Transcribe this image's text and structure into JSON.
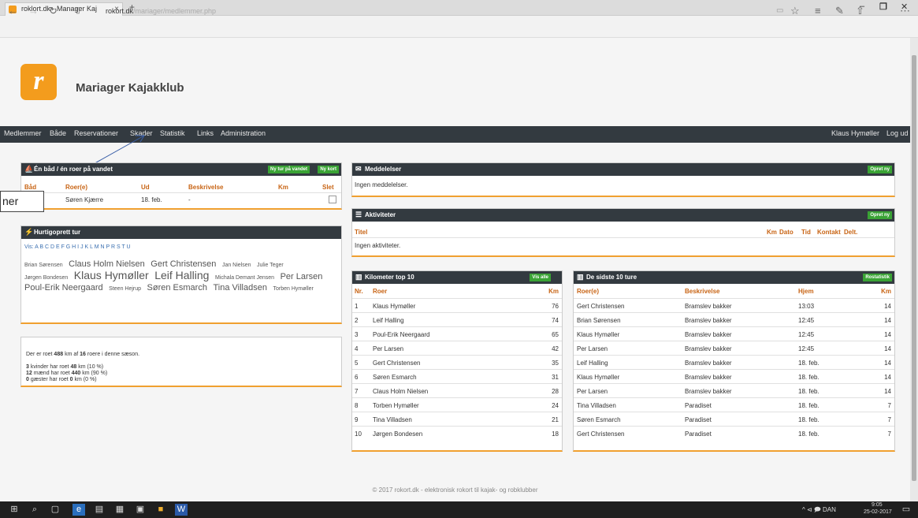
{
  "browser": {
    "tab_title": "roklort.dk - Manager Kaj",
    "tab_close": "×",
    "new_tab": "+",
    "address_host": "rokort.dk",
    "address_path": "/mariager/medlemmer.php",
    "win_min": "–",
    "win_max": "❐",
    "win_close": "✕",
    "icons": {
      "back": "arrow-left-icon",
      "forward": "arrow-right-icon",
      "refresh": "refresh-icon",
      "lock": "page-icon",
      "reading": "reading-view-icon",
      "favorite": "star-icon",
      "hub": "hub-icon",
      "notes": "pen-icon",
      "share": "share-icon",
      "more": "more-icon"
    }
  },
  "site": {
    "title": "Mariager Kajakklub",
    "logo_glyph": "r"
  },
  "menu": {
    "items": [
      "Medlemmer",
      "Både",
      "Reservationer",
      "Skader",
      "Statistik",
      "Links",
      "Administration"
    ],
    "user": "Klaus Hymøller",
    "logout": "Log ud"
  },
  "callout": {
    "text": "ner"
  },
  "panel_boats": {
    "title": "Én båd / én roer på vandet",
    "btn1": "Ny tur på vandet",
    "btn2": "Ny kort",
    "headers": [
      "Båd",
      "Roer(e)",
      "Ud",
      "Beskrivelse",
      "Km",
      "Slet"
    ],
    "row": {
      "boat": "",
      "rower": "Søren Kjærre",
      "out": "18. feb.",
      "desc": "-",
      "km": ""
    }
  },
  "panel_quick": {
    "title": "Hurtigoprett tur",
    "vis_label": "Vis:",
    "letters": "A B C D E F G H I J K L M N P R S T U",
    "names": [
      {
        "t": "Brian Sørensen",
        "s": 7
      },
      {
        "t": "Claus Holm Nielsen",
        "s": 11
      },
      {
        "t": "Gert Christensen",
        "s": 11
      },
      {
        "t": "Jan Nielsen",
        "s": 7
      },
      {
        "t": "Julie Teger",
        "s": 7
      },
      {
        "t": "Jørgen Bondesen",
        "s": 7
      },
      {
        "t": "Klaus Hymøller",
        "s": 14
      },
      {
        "t": "Leif Halling",
        "s": 14
      },
      {
        "t": "Michala Demant Jensen",
        "s": 7
      },
      {
        "t": "Per Larsen",
        "s": 11
      },
      {
        "t": "Poul-Erik Neergaard",
        "s": 11
      },
      {
        "t": "Steen Hejrup",
        "s": 7
      },
      {
        "t": "Søren Esmarch",
        "s": 11
      },
      {
        "t": "Tina Villadsen",
        "s": 11
      },
      {
        "t": "Torben Hymøller",
        "s": 7
      }
    ]
  },
  "panel_stats": {
    "line1_a": "Der er roet",
    "line1_km": "488",
    "line1_b": "km af",
    "line1_n": "16",
    "line1_c": "roere i denne sæson.",
    "line2_a": "3",
    "line2_b": "kvinder har roet",
    "line2_km": "48",
    "line2_c": "km (10 %)",
    "line3_a": "12",
    "line3_b": "mænd har roet",
    "line3_km": "440",
    "line3_c": "km (90 %)",
    "line4_a": "0",
    "line4_b": "gæster har roet",
    "line4_km": "0",
    "line4_c": "km (0 %)"
  },
  "panel_msg": {
    "title": "Meddelelser",
    "btn": "Opret ny",
    "text": "Ingen meddelelser."
  },
  "panel_act": {
    "title": "Aktiviteter",
    "btn": "Opret ny",
    "headers": [
      "Titel",
      "Km",
      "Dato",
      "Tid",
      "Kontakt",
      "Delt."
    ],
    "text": "Ingen aktiviteter."
  },
  "panel_top": {
    "title": "Kilometer top 10",
    "btn": "Vis alle",
    "headers": [
      "Nr.",
      "Roer",
      "Km"
    ],
    "rows": [
      [
        "1",
        "Klaus Hymøller",
        "76"
      ],
      [
        "2",
        "Leif Halling",
        "74"
      ],
      [
        "3",
        "Poul-Erik Neergaard",
        "65"
      ],
      [
        "4",
        "Per Larsen",
        "42"
      ],
      [
        "5",
        "Gert Christensen",
        "35"
      ],
      [
        "6",
        "Søren Esmarch",
        "31"
      ],
      [
        "7",
        "Claus Holm Nielsen",
        "28"
      ],
      [
        "8",
        "Torben Hymøller",
        "24"
      ],
      [
        "9",
        "Tina Villadsen",
        "21"
      ],
      [
        "10",
        "Jørgen Bondesen",
        "18"
      ]
    ]
  },
  "panel_last": {
    "title": "De sidste 10 ture",
    "btn": "Rostatistik",
    "headers": [
      "Roer(e)",
      "Beskrivelse",
      "Hjem",
      "Km"
    ],
    "rows": [
      [
        "Gert Christensen",
        "Bramslev bakker",
        "13:03",
        "14"
      ],
      [
        "Brian Sørensen",
        "Bramslev bakker",
        "12:45",
        "14"
      ],
      [
        "Klaus Hymøller",
        "Bramslev bakker",
        "12:45",
        "14"
      ],
      [
        "Per Larsen",
        "Bramslev bakker",
        "12:45",
        "14"
      ],
      [
        "Leif Halling",
        "Bramslev bakker",
        "18. feb.",
        "14"
      ],
      [
        "Klaus Hymøller",
        "Bramslev bakker",
        "18. feb.",
        "14"
      ],
      [
        "Per Larsen",
        "Bramslev bakker",
        "18. feb.",
        "14"
      ],
      [
        "Tina Villadsen",
        "Paradiset",
        "18. feb.",
        "7"
      ],
      [
        "Søren Esmarch",
        "Paradiset",
        "18. feb.",
        "7"
      ],
      [
        "Gert Christensen",
        "Paradiset",
        "18. feb.",
        "7"
      ]
    ]
  },
  "footer": {
    "text": "© 2017 rokort.dk - elektronisk rokort til kajak- og robklubber"
  },
  "taskbar": {
    "tray": "^ ⊲ 🗩 DAN",
    "time": "9:05",
    "date": "25-02-2017"
  }
}
